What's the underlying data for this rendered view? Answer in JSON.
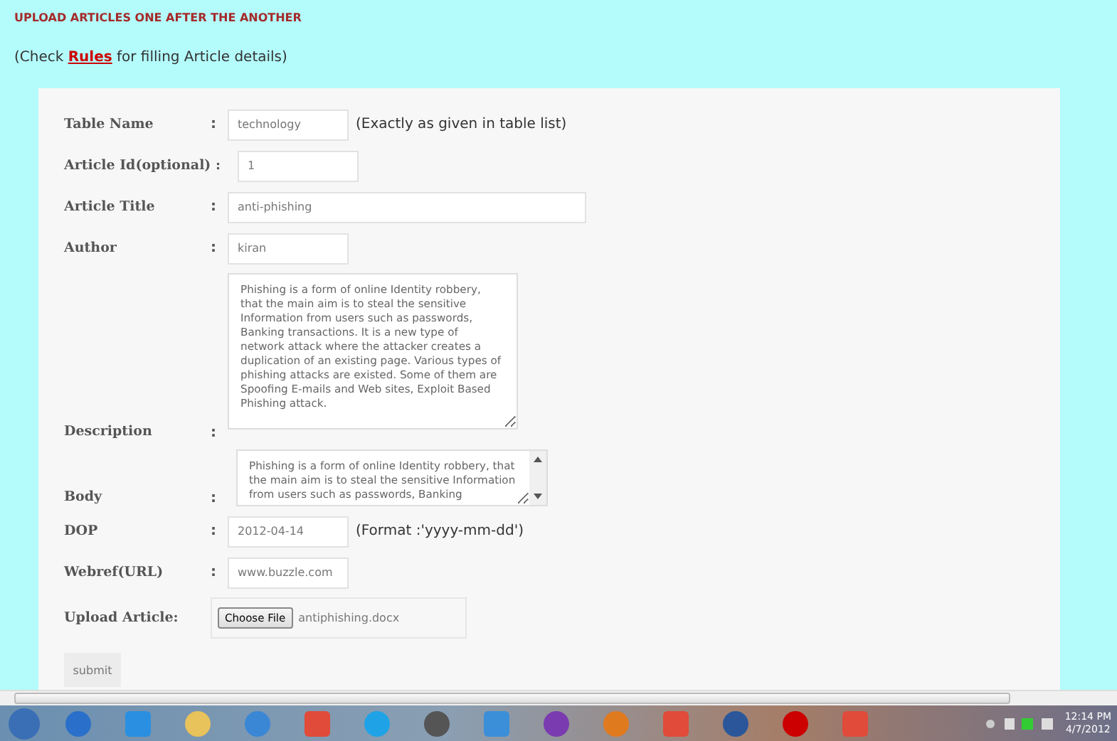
{
  "heading": "UPLOAD ARTICLES ONE AFTER THE ANOTHER",
  "rules_line": {
    "before": "(Check ",
    "link": "Rules",
    "after": " for filling Article details)"
  },
  "fields": [
    {
      "kind": "text",
      "label": "Table Name",
      "separator": ":",
      "value": "technology",
      "hint": "(Exactly as given in table list)"
    },
    {
      "kind": "text",
      "label": "Article Id(optional) :",
      "value": "1"
    },
    {
      "kind": "wide",
      "label": "Article Title",
      "separator": ":",
      "value": "anti-phishing"
    },
    {
      "kind": "text",
      "label": "Author",
      "separator": ":",
      "value": "kiran"
    },
    {
      "kind": "textarea",
      "label": "Description",
      "separator": ":",
      "value": "Phishing is a form of online Identity robbery, that the main aim is to steal the sensitive Information from users such as passwords, Banking transactions. It is a new type of network attack where the attacker creates a duplication of an existing page. Various types of phishing attacks are existed. Some of them are Spoofing E-mails and Web sites, Exploit Based Phishing attack."
    },
    {
      "kind": "scroll_textarea",
      "label": "Body",
      "separator": ":",
      "value": "Phishing is a form of online Identity robbery, that the main aim is to steal the sensitive Information from users such as passwords, Banking"
    },
    {
      "kind": "text",
      "label": "DOP",
      "separator": ":",
      "value": "2012-04-14",
      "hint": "(Format :'yyyy-mm-dd')"
    },
    {
      "kind": "text",
      "label": "Webref(URL)",
      "separator": ":",
      "value": "www.buzzle.com"
    },
    {
      "kind": "file",
      "label": "Upload Article:",
      "button": "Choose File",
      "value": "antiphishing.docx"
    }
  ],
  "submit": "submit",
  "clock": {
    "time": "12:14 PM",
    "date": "4/7/2012"
  }
}
